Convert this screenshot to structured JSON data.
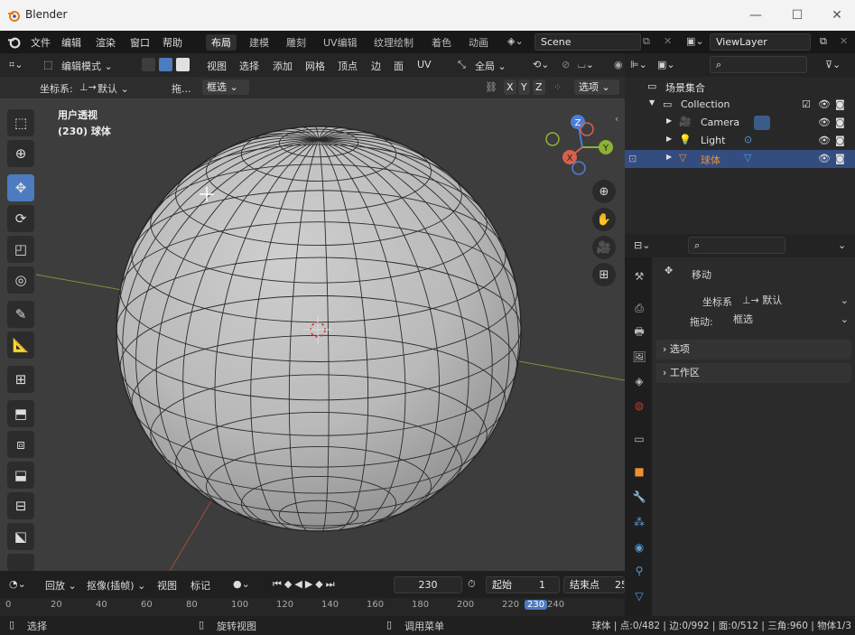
{
  "window": {
    "title": "Blender",
    "controls": {
      "minimize": "—",
      "maximize": "☐",
      "close": "✕"
    }
  },
  "menu": {
    "items": [
      "文件",
      "编辑",
      "渲染",
      "窗口",
      "帮助"
    ],
    "workspaces": [
      "布局",
      "建模",
      "雕刻",
      "UV编辑",
      "纹理绘制",
      "着色",
      "动画"
    ],
    "active_workspace": "布局",
    "scene": "Scene",
    "view_layer": "ViewLayer"
  },
  "viewport_header": {
    "mode": "编辑模式",
    "menus": [
      "视图",
      "选择",
      "添加",
      "网格",
      "顶点",
      "边",
      "面",
      "UV"
    ],
    "transform_orientation": "全局"
  },
  "tool_settings": {
    "coord_label": "坐标系:",
    "coord_value": "默认",
    "drag_label": "拖...",
    "select_value": "框选",
    "axes": [
      "X",
      "Y",
      "Z"
    ],
    "options": "选项"
  },
  "viewport_overlay": {
    "view_name": "用户透视",
    "object_info": "(230) 球体"
  },
  "gizmo": {
    "x": "X",
    "y": "Y",
    "z": "Z"
  },
  "outliner": {
    "root": "场景集合",
    "items": [
      {
        "name": "Collection"
      },
      {
        "name": "Camera"
      },
      {
        "name": "Light"
      },
      {
        "name": "球体"
      }
    ]
  },
  "properties": {
    "tool_name": "移动",
    "coord_label": "坐标系",
    "coord_value": "默认",
    "drag_label": "拖动:",
    "drag_value": "框选",
    "panels": [
      "选项",
      "工作区"
    ]
  },
  "timeline": {
    "playback": "回放",
    "keying": "抠像(插帧)",
    "view": "视图",
    "marker": "标记",
    "current_frame": "230",
    "start_label": "起始",
    "start_value": "1",
    "end_label": "结束点",
    "end_value": "25",
    "ruler_labels": [
      "0",
      "20",
      "40",
      "60",
      "80",
      "100",
      "120",
      "140",
      "160",
      "180",
      "200",
      "220",
      "230",
      "240"
    ]
  },
  "statusbar": {
    "select": "选择",
    "rotate": "旋转视图",
    "menu": "调用菜单",
    "stats": "球体 | 点:0/482 | 边:0/992 | 面:0/512 | 三角:960 | 物体1/3"
  },
  "colors": {
    "accent": "#4c7bbf",
    "selected_row": "#334d80",
    "x_axis": "#d8604a",
    "y_axis": "#8bb333",
    "z_axis": "#4b7fd6"
  }
}
